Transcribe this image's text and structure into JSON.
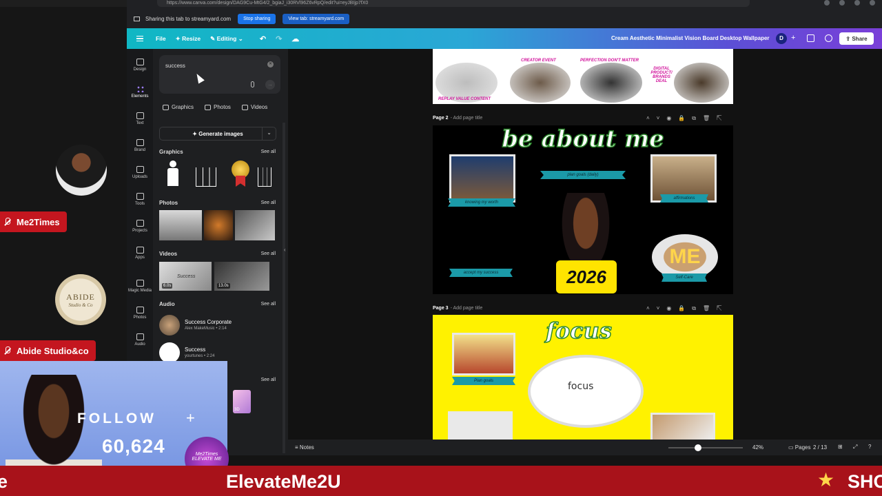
{
  "browser": {
    "url": "https://www.canva.com/design/DAG9Cu-MtG4/2_bgiaJ_i30RVl96Z6vRpQ/edit?ui=eyJBIjp7fX0",
    "share_notice": "Sharing this tab to streamyard.com",
    "stop_sharing": "Stop sharing",
    "view_tab": "View tab: streamyard.com"
  },
  "topbar": {
    "file": "File",
    "resize": "Resize",
    "editing": "Editing",
    "title": "Cream Aesthetic Minimalist Vision Board Desktop Wallpaper",
    "avatar": "D",
    "share": "Share"
  },
  "rail": [
    "Design",
    "Elements",
    "Text",
    "Brand",
    "Uploads",
    "Tools",
    "Projects",
    "Apps",
    "Magic Media",
    "Photos",
    "Audio"
  ],
  "panel": {
    "query": "success",
    "tabs": [
      "Graphics",
      "Photos",
      "Videos"
    ],
    "generate": "Generate images",
    "graphics_label": "Graphics",
    "photos_label": "Photos",
    "videos_label": "Videos",
    "audio_label": "Audio",
    "see_all": "See all",
    "video_durations": [
      "6.0s",
      "13.0s"
    ],
    "video_caption": "Success",
    "audio": [
      {
        "title": "Success Corporate",
        "sub": "Alex MakeMusic • 2:14"
      },
      {
        "title": "Success",
        "sub": "yourtunes • 2:24"
      }
    ],
    "extra_caption": "3D"
  },
  "canvas": {
    "page1": {
      "labels": [
        "CREATOR EVENT",
        "PERFECTION DON'T MATTER",
        "DIGITAL PRODUCT/ BRANDS DEAL",
        "REPLAY VALUE CONTENT"
      ]
    },
    "page2": {
      "num": "Page 2",
      "add_title": "- Add page title",
      "heading": "be about me",
      "tags": [
        "knowing my worth",
        "plan goals (daily)",
        "affirmations",
        "accept my success",
        "Self-Care"
      ],
      "year": "2026",
      "me": "ME"
    },
    "page3": {
      "num": "Page 3",
      "add_title": "- Add page title",
      "heading": "focus",
      "tags": [
        "Plan goals"
      ],
      "bulb": "focus"
    }
  },
  "bottombar": {
    "notes": "Notes",
    "zoom": "42%",
    "pages": "Pages",
    "count": "2 / 13"
  },
  "stream": {
    "names": [
      "Me2Times",
      "Abide Studio&co"
    ],
    "abide": "ABIDE",
    "follow": "FOLLOW",
    "followers": "60,624",
    "badge": "Me2Times ELEVATE ME",
    "banner": "ElevateMe2U",
    "banner_right": "SHO"
  }
}
